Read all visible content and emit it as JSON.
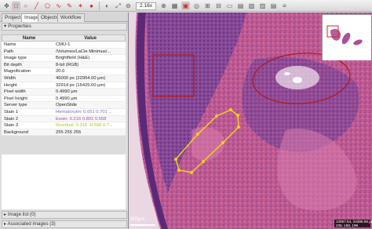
{
  "toolbar": {
    "zoom": "2.16x"
  },
  "tabs": [
    "Project",
    "Image",
    "Objects",
    "Workflow"
  ],
  "properties": {
    "title": "Properties",
    "columns": [
      "Name",
      "Value"
    ],
    "rows": [
      {
        "name": "Name",
        "value": "CMU-1"
      },
      {
        "name": "Path",
        "value": "/Volumes/LaCie Minimus/..."
      },
      {
        "name": "Image type",
        "value": "Brightfield (H&E)"
      },
      {
        "name": "Bit depth",
        "value": "8-bit (RGB)"
      },
      {
        "name": "Magnification",
        "value": "20.0"
      },
      {
        "name": "Width",
        "value": "46000 px (22954.00 µm)"
      },
      {
        "name": "Height",
        "value": "32914 px (16425.00 µm)"
      },
      {
        "name": "Pixel width",
        "value": "0.4990 µm"
      },
      {
        "name": "Pixel height",
        "value": "0.4990 µm"
      },
      {
        "name": "Server type",
        "value": "OpenSlide"
      },
      {
        "name": "Stain 1",
        "value": "Hematoxylin: 0.651 0.701 ...",
        "color": "#6f6fc8"
      },
      {
        "name": "Stain 2",
        "value": "Eosin: 0.216 0.801 0.558",
        "color": "#c040a0"
      },
      {
        "name": "Stain 3",
        "value": "Residual: 0.316 -0.598 0.7...",
        "color": "#a8c820"
      },
      {
        "name": "Background",
        "value": "255 255 255"
      }
    ]
  },
  "panels": {
    "image_list": "Image list (0)",
    "associated_images": "Associated images (3)"
  },
  "viewer": {
    "scale_label": "800µm",
    "coords": "13957.54, 24396.99 µm\n235, 188, 199"
  }
}
